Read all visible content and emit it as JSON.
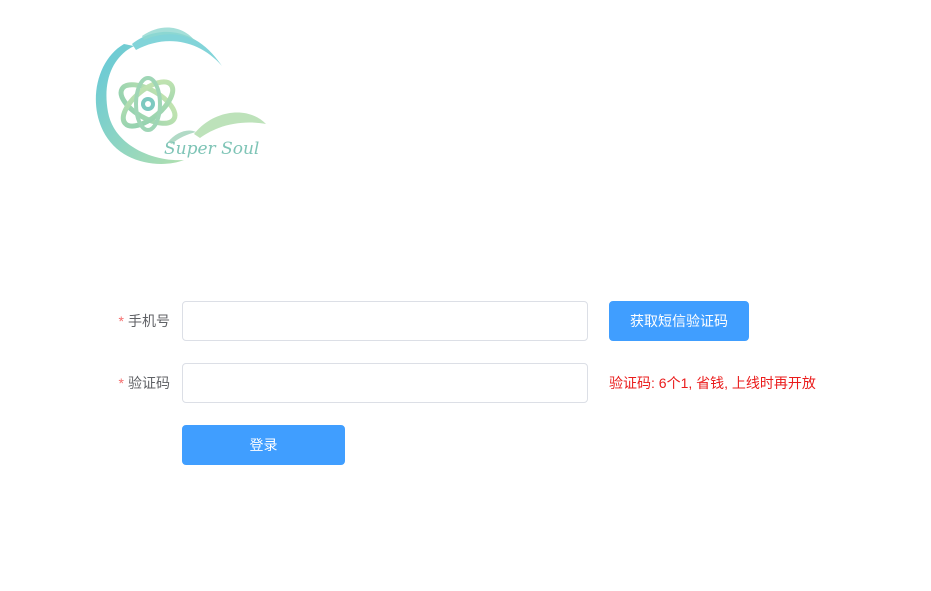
{
  "logo": {
    "text": "Super Soul",
    "colors": {
      "teal": "#5ec8d3",
      "green": "#a6d9a8"
    }
  },
  "form": {
    "phone": {
      "required_mark": "*",
      "label": "手机号",
      "value": "",
      "placeholder": ""
    },
    "code": {
      "required_mark": "*",
      "label": "验证码",
      "value": "",
      "placeholder": ""
    },
    "send_code_button": "获取短信验证码",
    "code_hint": "验证码: 6个1, 省钱, 上线时再开放",
    "login_button": "登录"
  },
  "colors": {
    "primary": "#409eff",
    "required": "#f56c6c",
    "hint": "#ea1c1c",
    "label": "#606266",
    "border": "#dcdfe6"
  }
}
